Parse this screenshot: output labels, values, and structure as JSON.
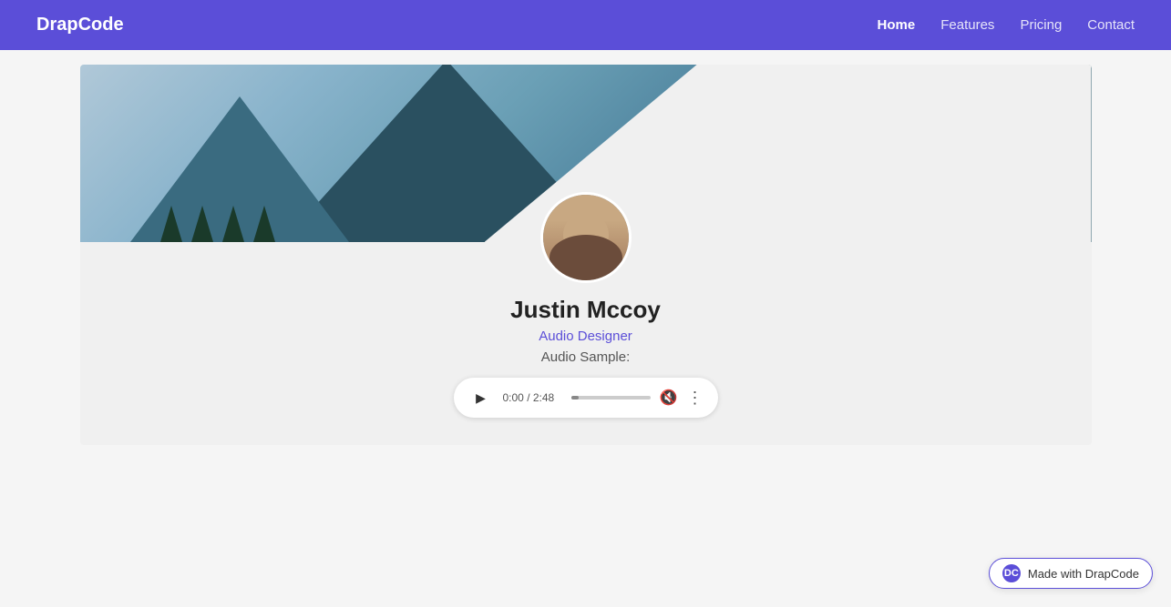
{
  "nav": {
    "brand": "DrapCode",
    "links": [
      {
        "label": "Home",
        "active": true
      },
      {
        "label": "Features",
        "active": false
      },
      {
        "label": "Pricing",
        "active": false
      },
      {
        "label": "Contact",
        "active": false
      }
    ]
  },
  "profile": {
    "name": "Justin Mccoy",
    "title": "Audio Designer",
    "audio_label": "Audio Sample:",
    "time": "0:00 / 2:48"
  },
  "badge": {
    "icon_label": "DC",
    "text": "Made with DrapCode"
  }
}
